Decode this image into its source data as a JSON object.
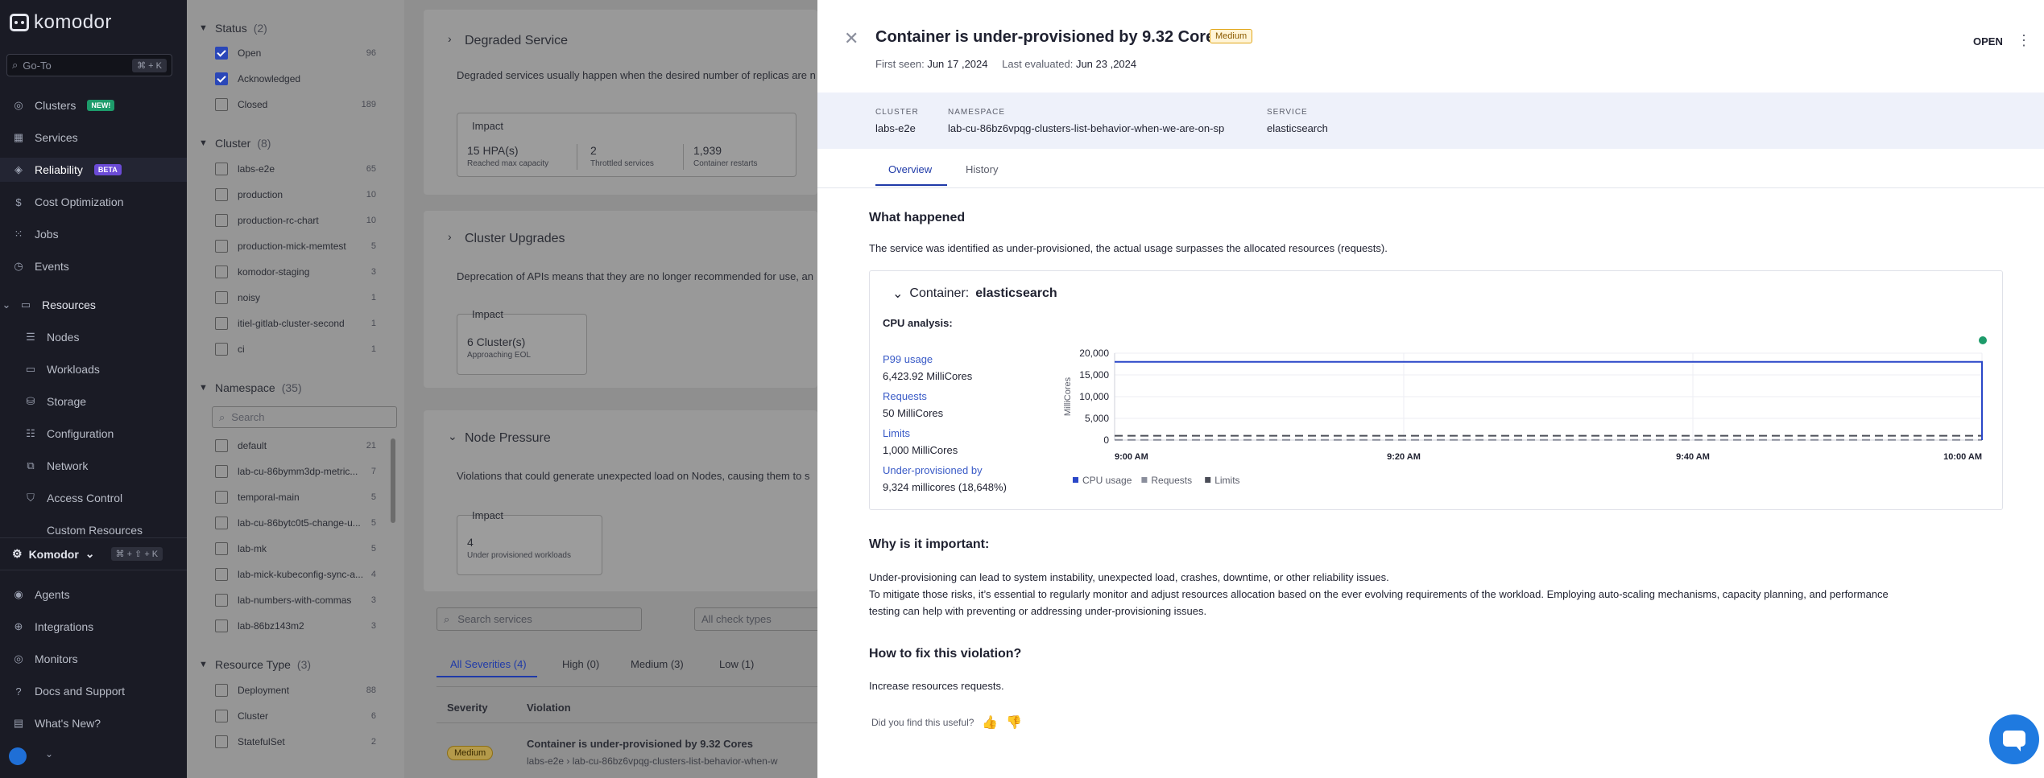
{
  "sidebar": {
    "brand": "komodor",
    "search_placeholder": "Go-To",
    "search_shortcut": "⌘ + K",
    "nav": [
      {
        "label": "Clusters",
        "badge": "NEW!"
      },
      {
        "label": "Services"
      },
      {
        "label": "Reliability",
        "badge": "BETA"
      },
      {
        "label": "Cost Optimization"
      },
      {
        "label": "Jobs"
      },
      {
        "label": "Events"
      }
    ],
    "resources_label": "Resources",
    "resources": [
      "Nodes",
      "Workloads",
      "Storage",
      "Configuration",
      "Network",
      "Access Control",
      "Custom Resources"
    ],
    "workspace": "Komodor",
    "workspace_shortcut": "⌘ + ⇧ + K",
    "bottom": [
      "Agents",
      "Integrations",
      "Monitors",
      "Docs and Support",
      "What's New?"
    ]
  },
  "filters": {
    "status": {
      "title": "Status",
      "count": "(2)",
      "items": [
        {
          "label": "Open",
          "num": "96",
          "checked": true
        },
        {
          "label": "Acknowledged",
          "num": "",
          "checked": true
        },
        {
          "label": "Closed",
          "num": "189",
          "checked": false
        }
      ]
    },
    "cluster": {
      "title": "Cluster",
      "count": "(8)",
      "items": [
        {
          "label": "labs-e2e",
          "num": "65"
        },
        {
          "label": "production",
          "num": "10"
        },
        {
          "label": "production-rc-chart",
          "num": "10"
        },
        {
          "label": "production-mick-memtest",
          "num": "5"
        },
        {
          "label": "komodor-staging",
          "num": "3"
        },
        {
          "label": "noisy",
          "num": "1"
        },
        {
          "label": "itiel-gitlab-cluster-second",
          "num": "1"
        },
        {
          "label": "ci",
          "num": "1"
        }
      ]
    },
    "namespace": {
      "title": "Namespace",
      "count": "(35)",
      "search_placeholder": "Search",
      "items": [
        {
          "label": "default",
          "num": "21"
        },
        {
          "label": "lab-cu-86bymm3dp-metric...",
          "num": "7"
        },
        {
          "label": "temporal-main",
          "num": "5"
        },
        {
          "label": "lab-cu-86bytc0t5-change-u...",
          "num": "5"
        },
        {
          "label": "lab-mk",
          "num": "5"
        },
        {
          "label": "lab-mick-kubeconfig-sync-a...",
          "num": "4"
        },
        {
          "label": "lab-numbers-with-commas",
          "num": "3"
        },
        {
          "label": "lab-86bz143m2",
          "num": "3"
        }
      ]
    },
    "resource_type": {
      "title": "Resource Type",
      "count": "(3)",
      "items": [
        {
          "label": "Deployment",
          "num": "88"
        },
        {
          "label": "Cluster",
          "num": "6"
        },
        {
          "label": "StatefulSet",
          "num": "2"
        }
      ]
    }
  },
  "main": {
    "cards": [
      {
        "title": "Degraded Service",
        "desc": "Degraded services usually happen when the desired number of replicas are n",
        "impact_label": "Impact",
        "cells": [
          {
            "val": "15 HPA(s)",
            "sub": "Reached max capacity"
          },
          {
            "val": "2",
            "sub": "Throttled services"
          },
          {
            "val": "1,939",
            "sub": "Container restarts"
          }
        ]
      },
      {
        "title": "Cluster Upgrades",
        "desc": "Deprecation of APIs means that they are no longer recommended for use, an",
        "impact_label": "Impact",
        "cells": [
          {
            "val": "6 Cluster(s)",
            "sub": "Approaching EOL"
          }
        ]
      },
      {
        "title": "Node Pressure",
        "desc": "Violations that could generate unexpected load on Nodes, causing them to s",
        "impact_label": "Impact",
        "cells": [
          {
            "val": "4",
            "sub": "Under provisioned workloads"
          }
        ]
      }
    ],
    "search_placeholder": "Search services",
    "check_types": "All check types",
    "severity_tabs": [
      "All Severities (4)",
      "High (0)",
      "Medium (3)",
      "Low (1)"
    ],
    "table_headers": [
      "Severity",
      "Violation"
    ],
    "row": {
      "severity": "Medium",
      "title": "Container is under-provisioned by 9.32 Cores",
      "cluster": "labs-e2e",
      "sep": "›",
      "ns": "lab-cu-86bz6vpqg-clusters-list-behavior-when-w"
    }
  },
  "drawer": {
    "title": "Container is under-provisioned by 9.32 Cores",
    "severity": "Medium",
    "first_seen_label": "First seen:",
    "first_seen": "Jun 17 ,2024",
    "last_eval_label": "Last evaluated:",
    "last_eval": "Jun 23 ,2024",
    "status": "OPEN",
    "cluster_label": "CLUSTER",
    "cluster": "labs-e2e",
    "namespace_label": "NAMESPACE",
    "namespace": "lab-cu-86bz6vpqg-clusters-list-behavior-when-we-are-on-sp",
    "service_label": "SERVICE",
    "service": "elasticsearch",
    "tabs": [
      "Overview",
      "History"
    ],
    "what_happened_h": "What happened",
    "what_happened": "The service was identified as under-provisioned, the actual usage surpasses the allocated resources (requests).",
    "container_label": "Container:",
    "container_name": "elasticsearch",
    "cpu_analysis": "CPU analysis:",
    "metrics": [
      {
        "k": "P99 usage",
        "v": "6,423.92 MilliCores"
      },
      {
        "k": "Requests",
        "v": "50 MilliCores"
      },
      {
        "k": "Limits",
        "v": "1,000 MilliCores"
      },
      {
        "k": "Under-provisioned by",
        "v": "9,324 millicores (18,648%)"
      }
    ],
    "why_h": "Why is it important:",
    "why_1": "Under-provisioning can lead to system instability, unexpected load, crashes, downtime, or other reliability issues.",
    "why_2": "To mitigate those risks, it’s essential to regularly monitor and adjust resources allocation based on the ever evolving requirements of the workload. Employing auto-scaling mechanisms, capacity planning, and performance",
    "why_3": "testing can help with preventing or addressing under-provisioning issues.",
    "fix_h": "How to fix this violation?",
    "fix": "Increase resources requests.",
    "feedback": "Did you find this useful?"
  },
  "chart_data": {
    "type": "line",
    "ylabel": "MilliCores",
    "ylim": [
      0,
      20000
    ],
    "yticks": [
      "20,000",
      "15,000",
      "10,000",
      "5,000",
      "0"
    ],
    "ytick_values": [
      20000,
      15000,
      10000,
      5000,
      0
    ],
    "xticks": [
      "9:00 AM",
      "9:20 AM",
      "9:40 AM",
      "10:00 AM"
    ],
    "x_minutes": [
      0,
      60
    ],
    "series": [
      {
        "name": "CPU usage",
        "color": "#2a47c8",
        "values": [
          18000,
          18000
        ]
      },
      {
        "name": "Requests",
        "color": "#8a8e9c",
        "values": [
          50,
          50
        ]
      },
      {
        "name": "Limits",
        "color": "#4a4d57",
        "values": [
          1000,
          1000
        ]
      }
    ]
  }
}
